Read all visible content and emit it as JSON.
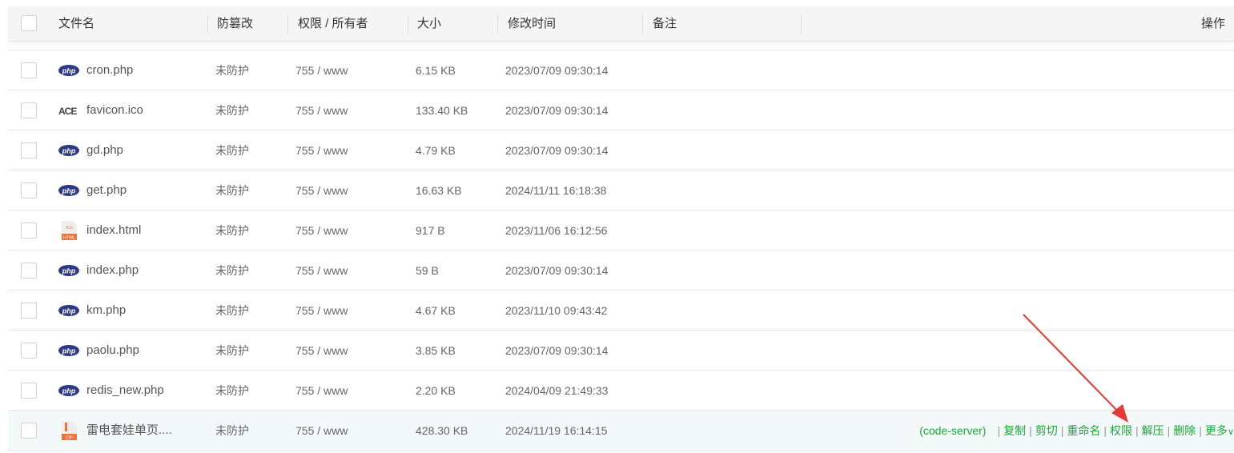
{
  "header": {
    "filename": "文件名",
    "tamper": "防篡改",
    "perm": "权限 / 所有者",
    "size": "大小",
    "mtime": "修改时间",
    "remark": "备注",
    "actions": "操作"
  },
  "rows": [
    {
      "icon": "php",
      "name": "cron.php",
      "tamper": "未防护",
      "perm": "755 / www",
      "size": "6.15 KB",
      "mtime": "2023/07/09 09:30:14"
    },
    {
      "icon": "ace",
      "name": "favicon.ico",
      "tamper": "未防护",
      "perm": "755 / www",
      "size": "133.40 KB",
      "mtime": "2023/07/09 09:30:14"
    },
    {
      "icon": "php",
      "name": "gd.php",
      "tamper": "未防护",
      "perm": "755 / www",
      "size": "4.79 KB",
      "mtime": "2023/07/09 09:30:14"
    },
    {
      "icon": "php",
      "name": "get.php",
      "tamper": "未防护",
      "perm": "755 / www",
      "size": "16.63 KB",
      "mtime": "2024/11/11 16:18:38"
    },
    {
      "icon": "html",
      "name": "index.html",
      "tamper": "未防护",
      "perm": "755 / www",
      "size": "917 B",
      "mtime": "2023/11/06 16:12:56"
    },
    {
      "icon": "php",
      "name": "index.php",
      "tamper": "未防护",
      "perm": "755 / www",
      "size": "59 B",
      "mtime": "2023/07/09 09:30:14"
    },
    {
      "icon": "php",
      "name": "km.php",
      "tamper": "未防护",
      "perm": "755 / www",
      "size": "4.67 KB",
      "mtime": "2023/11/10 09:43:42"
    },
    {
      "icon": "php",
      "name": "paolu.php",
      "tamper": "未防护",
      "perm": "755 / www",
      "size": "3.85 KB",
      "mtime": "2023/07/09 09:30:14"
    },
    {
      "icon": "php",
      "name": "redis_new.php",
      "tamper": "未防护",
      "perm": "755 / www",
      "size": "2.20 KB",
      "mtime": "2024/04/09 21:49:33"
    },
    {
      "icon": "zip",
      "name": "雷电套娃单页....",
      "tamper": "未防护",
      "perm": "755 / www",
      "size": "428.30 KB",
      "mtime": "2024/11/19 16:14:15",
      "selected": true
    }
  ],
  "row_actions": {
    "code_server": "(code-server)",
    "items": [
      "复制",
      "剪切",
      "重命名",
      "权限",
      "解压",
      "删除",
      "更多"
    ]
  },
  "icon_labels": {
    "php": "php",
    "ace": "ACE",
    "html": "HTML",
    "zip": "ZIP"
  },
  "colors": {
    "accent": "#20a53a",
    "arrow": "#e53935",
    "php": "#2e3a87"
  }
}
